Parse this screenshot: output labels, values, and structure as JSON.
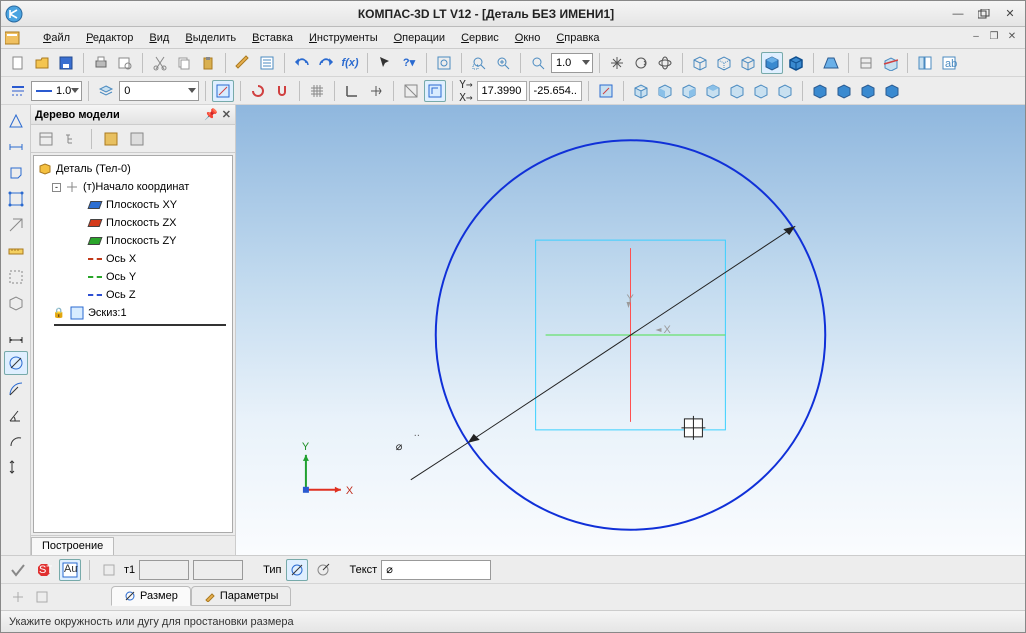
{
  "title": "КОМПАС-3D LT V12 - [Деталь БЕЗ ИМЕНИ1]",
  "menu": [
    "Файл",
    "Редактор",
    "Вид",
    "Выделить",
    "Вставка",
    "Инструменты",
    "Операции",
    "Сервис",
    "Окно",
    "Справка"
  ],
  "toolbar1": {
    "zoom_combo": "1.0"
  },
  "toolbar2": {
    "style_combo": "1.0",
    "layer_combo": "0",
    "coord_x": "17.3990",
    "coord_y": "-25.654.."
  },
  "panel": {
    "title": "Дерево модели",
    "root": "Деталь (Тел-0)",
    "origin": "(т)Начало координат",
    "items": [
      {
        "label": "Плоскость XY",
        "type": "plane",
        "color": "#2d6fd2"
      },
      {
        "label": "Плоскость ZX",
        "type": "plane",
        "color": "#d43a1a"
      },
      {
        "label": "Плоскость ZY",
        "type": "plane",
        "color": "#2aa52a"
      },
      {
        "label": "Ось X",
        "type": "axis",
        "color": "#c23a1a"
      },
      {
        "label": "Ось Y",
        "type": "axis",
        "color": "#2aa52a"
      },
      {
        "label": "Ось Z",
        "type": "axis",
        "color": "#2d4fd2"
      }
    ],
    "sketch": "Эскиз:1",
    "tab": "Построение"
  },
  "canvas": {
    "axis_x_label": "X",
    "axis_y_label": "Y",
    "mini_x": "X",
    "mini_y": "Y",
    "diameter_symbol": "⌀"
  },
  "props": {
    "т1_label": "т1",
    "type_label": "Тип",
    "text_label": "Текст",
    "text_value": "⌀",
    "tab_dim": "Размер",
    "tab_param": "Параметры"
  },
  "status": "Укажите окружность или дугу для простановки размера"
}
